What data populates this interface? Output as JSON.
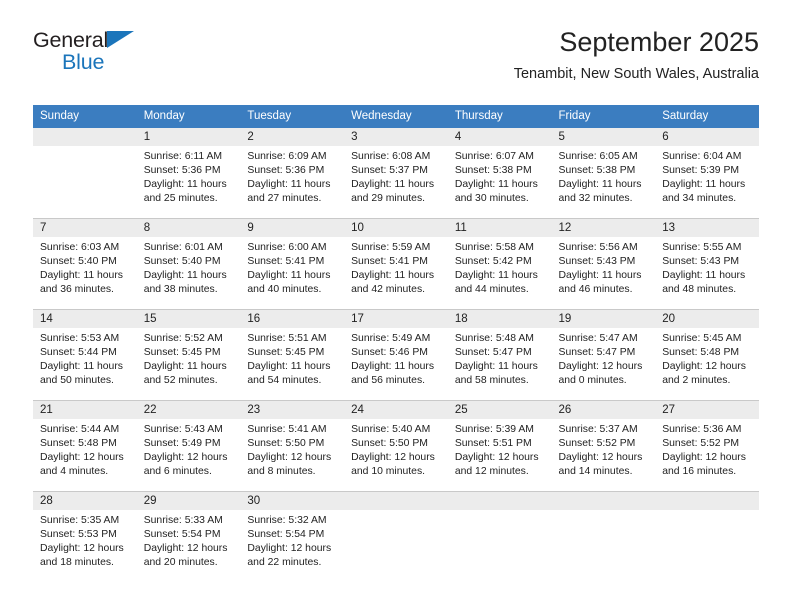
{
  "brand": {
    "name_part1": "General",
    "name_part2": "Blue",
    "flag_icon": "triangle-flag-icon"
  },
  "header": {
    "title": "September 2025",
    "subtitle": "Tenambit, New South Wales, Australia"
  },
  "colors": {
    "header_row_bg": "#3b7dc0",
    "header_row_text": "#ffffff",
    "daynum_bg": "#ececec",
    "brand_blue": "#1b75bb",
    "grid_line": "#c9c9c9",
    "body_text": "#222222"
  },
  "calendar": {
    "weekday_headers": [
      "Sunday",
      "Monday",
      "Tuesday",
      "Wednesday",
      "Thursday",
      "Friday",
      "Saturday"
    ],
    "weeks": [
      [
        {
          "day": "",
          "empty": true,
          "sunrise": "",
          "sunset": "",
          "daylight_line1": "",
          "daylight_line2": ""
        },
        {
          "day": "1",
          "sunrise": "Sunrise: 6:11 AM",
          "sunset": "Sunset: 5:36 PM",
          "daylight_line1": "Daylight: 11 hours",
          "daylight_line2": "and 25 minutes."
        },
        {
          "day": "2",
          "sunrise": "Sunrise: 6:09 AM",
          "sunset": "Sunset: 5:36 PM",
          "daylight_line1": "Daylight: 11 hours",
          "daylight_line2": "and 27 minutes."
        },
        {
          "day": "3",
          "sunrise": "Sunrise: 6:08 AM",
          "sunset": "Sunset: 5:37 PM",
          "daylight_line1": "Daylight: 11 hours",
          "daylight_line2": "and 29 minutes."
        },
        {
          "day": "4",
          "sunrise": "Sunrise: 6:07 AM",
          "sunset": "Sunset: 5:38 PM",
          "daylight_line1": "Daylight: 11 hours",
          "daylight_line2": "and 30 minutes."
        },
        {
          "day": "5",
          "sunrise": "Sunrise: 6:05 AM",
          "sunset": "Sunset: 5:38 PM",
          "daylight_line1": "Daylight: 11 hours",
          "daylight_line2": "and 32 minutes."
        },
        {
          "day": "6",
          "sunrise": "Sunrise: 6:04 AM",
          "sunset": "Sunset: 5:39 PM",
          "daylight_line1": "Daylight: 11 hours",
          "daylight_line2": "and 34 minutes."
        }
      ],
      [
        {
          "day": "7",
          "sunrise": "Sunrise: 6:03 AM",
          "sunset": "Sunset: 5:40 PM",
          "daylight_line1": "Daylight: 11 hours",
          "daylight_line2": "and 36 minutes."
        },
        {
          "day": "8",
          "sunrise": "Sunrise: 6:01 AM",
          "sunset": "Sunset: 5:40 PM",
          "daylight_line1": "Daylight: 11 hours",
          "daylight_line2": "and 38 minutes."
        },
        {
          "day": "9",
          "sunrise": "Sunrise: 6:00 AM",
          "sunset": "Sunset: 5:41 PM",
          "daylight_line1": "Daylight: 11 hours",
          "daylight_line2": "and 40 minutes."
        },
        {
          "day": "10",
          "sunrise": "Sunrise: 5:59 AM",
          "sunset": "Sunset: 5:41 PM",
          "daylight_line1": "Daylight: 11 hours",
          "daylight_line2": "and 42 minutes."
        },
        {
          "day": "11",
          "sunrise": "Sunrise: 5:58 AM",
          "sunset": "Sunset: 5:42 PM",
          "daylight_line1": "Daylight: 11 hours",
          "daylight_line2": "and 44 minutes."
        },
        {
          "day": "12",
          "sunrise": "Sunrise: 5:56 AM",
          "sunset": "Sunset: 5:43 PM",
          "daylight_line1": "Daylight: 11 hours",
          "daylight_line2": "and 46 minutes."
        },
        {
          "day": "13",
          "sunrise": "Sunrise: 5:55 AM",
          "sunset": "Sunset: 5:43 PM",
          "daylight_line1": "Daylight: 11 hours",
          "daylight_line2": "and 48 minutes."
        }
      ],
      [
        {
          "day": "14",
          "sunrise": "Sunrise: 5:53 AM",
          "sunset": "Sunset: 5:44 PM",
          "daylight_line1": "Daylight: 11 hours",
          "daylight_line2": "and 50 minutes."
        },
        {
          "day": "15",
          "sunrise": "Sunrise: 5:52 AM",
          "sunset": "Sunset: 5:45 PM",
          "daylight_line1": "Daylight: 11 hours",
          "daylight_line2": "and 52 minutes."
        },
        {
          "day": "16",
          "sunrise": "Sunrise: 5:51 AM",
          "sunset": "Sunset: 5:45 PM",
          "daylight_line1": "Daylight: 11 hours",
          "daylight_line2": "and 54 minutes."
        },
        {
          "day": "17",
          "sunrise": "Sunrise: 5:49 AM",
          "sunset": "Sunset: 5:46 PM",
          "daylight_line1": "Daylight: 11 hours",
          "daylight_line2": "and 56 minutes."
        },
        {
          "day": "18",
          "sunrise": "Sunrise: 5:48 AM",
          "sunset": "Sunset: 5:47 PM",
          "daylight_line1": "Daylight: 11 hours",
          "daylight_line2": "and 58 minutes."
        },
        {
          "day": "19",
          "sunrise": "Sunrise: 5:47 AM",
          "sunset": "Sunset: 5:47 PM",
          "daylight_line1": "Daylight: 12 hours",
          "daylight_line2": "and 0 minutes."
        },
        {
          "day": "20",
          "sunrise": "Sunrise: 5:45 AM",
          "sunset": "Sunset: 5:48 PM",
          "daylight_line1": "Daylight: 12 hours",
          "daylight_line2": "and 2 minutes."
        }
      ],
      [
        {
          "day": "21",
          "sunrise": "Sunrise: 5:44 AM",
          "sunset": "Sunset: 5:48 PM",
          "daylight_line1": "Daylight: 12 hours",
          "daylight_line2": "and 4 minutes."
        },
        {
          "day": "22",
          "sunrise": "Sunrise: 5:43 AM",
          "sunset": "Sunset: 5:49 PM",
          "daylight_line1": "Daylight: 12 hours",
          "daylight_line2": "and 6 minutes."
        },
        {
          "day": "23",
          "sunrise": "Sunrise: 5:41 AM",
          "sunset": "Sunset: 5:50 PM",
          "daylight_line1": "Daylight: 12 hours",
          "daylight_line2": "and 8 minutes."
        },
        {
          "day": "24",
          "sunrise": "Sunrise: 5:40 AM",
          "sunset": "Sunset: 5:50 PM",
          "daylight_line1": "Daylight: 12 hours",
          "daylight_line2": "and 10 minutes."
        },
        {
          "day": "25",
          "sunrise": "Sunrise: 5:39 AM",
          "sunset": "Sunset: 5:51 PM",
          "daylight_line1": "Daylight: 12 hours",
          "daylight_line2": "and 12 minutes."
        },
        {
          "day": "26",
          "sunrise": "Sunrise: 5:37 AM",
          "sunset": "Sunset: 5:52 PM",
          "daylight_line1": "Daylight: 12 hours",
          "daylight_line2": "and 14 minutes."
        },
        {
          "day": "27",
          "sunrise": "Sunrise: 5:36 AM",
          "sunset": "Sunset: 5:52 PM",
          "daylight_line1": "Daylight: 12 hours",
          "daylight_line2": "and 16 minutes."
        }
      ],
      [
        {
          "day": "28",
          "sunrise": "Sunrise: 5:35 AM",
          "sunset": "Sunset: 5:53 PM",
          "daylight_line1": "Daylight: 12 hours",
          "daylight_line2": "and 18 minutes."
        },
        {
          "day": "29",
          "sunrise": "Sunrise: 5:33 AM",
          "sunset": "Sunset: 5:54 PM",
          "daylight_line1": "Daylight: 12 hours",
          "daylight_line2": "and 20 minutes."
        },
        {
          "day": "30",
          "sunrise": "Sunrise: 5:32 AM",
          "sunset": "Sunset: 5:54 PM",
          "daylight_line1": "Daylight: 12 hours",
          "daylight_line2": "and 22 minutes."
        },
        {
          "day": "",
          "empty": true,
          "sunrise": "",
          "sunset": "",
          "daylight_line1": "",
          "daylight_line2": ""
        },
        {
          "day": "",
          "empty": true,
          "sunrise": "",
          "sunset": "",
          "daylight_line1": "",
          "daylight_line2": ""
        },
        {
          "day": "",
          "empty": true,
          "sunrise": "",
          "sunset": "",
          "daylight_line1": "",
          "daylight_line2": ""
        },
        {
          "day": "",
          "empty": true,
          "sunrise": "",
          "sunset": "",
          "daylight_line1": "",
          "daylight_line2": ""
        }
      ]
    ]
  }
}
